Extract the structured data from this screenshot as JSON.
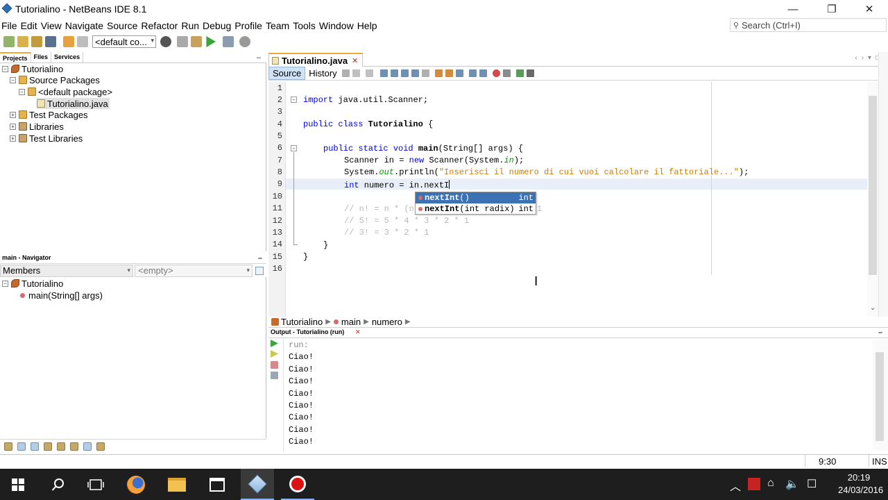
{
  "window": {
    "title": "Tutorialino - NetBeans IDE 8.1",
    "minimize": "—",
    "restore": "❐",
    "close": "✕"
  },
  "menu": [
    "File",
    "Edit",
    "View",
    "Navigate",
    "Source",
    "Refactor",
    "Run",
    "Debug",
    "Profile",
    "Team",
    "Tools",
    "Window",
    "Help"
  ],
  "search": {
    "placeholder": "Search (Ctrl+I)"
  },
  "toolbar": {
    "config": "<default co..."
  },
  "project_tabs": [
    "Projects",
    "Files",
    "Services"
  ],
  "project_tree": [
    {
      "label": "Tutorialino",
      "level": 0,
      "icon": "project-icon",
      "toggle": "−"
    },
    {
      "label": "Source Packages",
      "level": 1,
      "icon": "package-folder-icon",
      "toggle": "−"
    },
    {
      "label": "<default package>",
      "level": 2,
      "icon": "package-icon",
      "toggle": "−"
    },
    {
      "label": "Tutorialino.java",
      "level": 3,
      "icon": "java-file-icon",
      "toggle": ""
    },
    {
      "label": "Test Packages",
      "level": 1,
      "icon": "package-folder-icon",
      "toggle": "+"
    },
    {
      "label": "Libraries",
      "level": 1,
      "icon": "library-icon",
      "toggle": "+"
    },
    {
      "label": "Test Libraries",
      "level": 1,
      "icon": "library-icon",
      "toggle": "+"
    }
  ],
  "navigator": {
    "header": "main - Navigator",
    "members_label": "Members",
    "filter_value": "<empty>",
    "tree": [
      {
        "label": "Tutorialino",
        "level": 0
      },
      {
        "label": "main(String[] args)",
        "level": 1
      }
    ]
  },
  "editor": {
    "tab": "Tutorialino.java",
    "tab_close": "✕",
    "source_button": "Source",
    "history_button": "History",
    "line_numbers": [
      "1",
      "2",
      "3",
      "4",
      "5",
      "6",
      "7",
      "8",
      "9",
      "10",
      "11",
      "12",
      "13",
      "14",
      "15",
      "16"
    ],
    "code": {
      "l2_kw": "import",
      "l2_rest": " java.util.Scanner;",
      "l4_kw": "public class",
      "l4_name": "Tutorialino",
      "l4_rest": " {",
      "l6_kw": "public static void",
      "l6_name": "main",
      "l6_rest": "(String[] args) {",
      "l7_a": "Scanner in = ",
      "l7_kw": "new",
      "l7_b": " Scanner(System.",
      "l7_it": "in",
      "l7_c": ");",
      "l8_a": "System.",
      "l8_it": "out",
      "l8_b": ".println(",
      "l8_str": "\"Inserisci il numero di cui vuoi calcolare il fattoriale...\"",
      "l8_c": ");",
      "l9_kw": "int",
      "l9_rest": " numero = in.nextI",
      "l11": "// n! = n * (n",
      "l11_tail": "1",
      "l12": "// 5! = 5 * 4 * 3 * 2 * 1",
      "l13": "// 3! = 3 * 2 * 1",
      "l14": "}",
      "l15": "}"
    },
    "completion": [
      {
        "name": "nextInt",
        "params": "()",
        "type": "int"
      },
      {
        "name": "nextInt",
        "params": "(int radix)",
        "type": "int"
      }
    ]
  },
  "breadcrumb": [
    "Tutorialino",
    "main",
    "numero"
  ],
  "output": {
    "header": "Output - Tutorialino (run)",
    "lines": [
      "run:",
      "Ciao!",
      "Ciao!",
      "Ciao!",
      "Ciao!",
      "Ciao!",
      "Ciao!",
      "Ciao!",
      "Ciao!"
    ]
  },
  "status": {
    "position": "9:30",
    "mode": "INS"
  },
  "taskbar": {
    "time": "20:19",
    "date": "24/03/2016"
  }
}
